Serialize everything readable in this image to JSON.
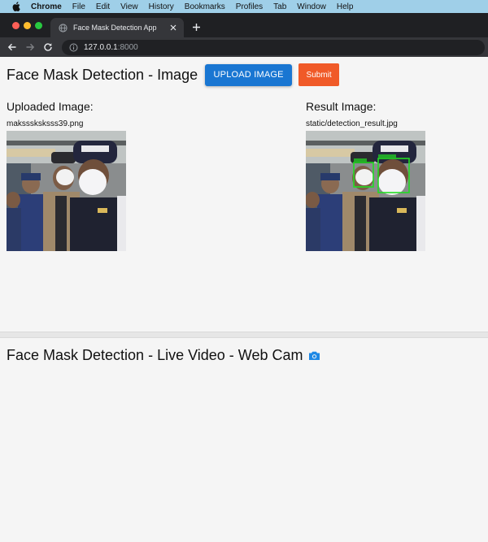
{
  "menubar": {
    "app": "Chrome",
    "items": [
      "File",
      "Edit",
      "View",
      "History",
      "Bookmarks",
      "Profiles",
      "Tab",
      "Window",
      "Help"
    ]
  },
  "browser": {
    "tab_title": "Face Mask Detection App",
    "url_host": "127.0.0.1",
    "url_port": ":8000"
  },
  "page": {
    "image_heading": "Face Mask Detection - Image",
    "upload_button": "UPLOAD IMAGE",
    "submit_button": "Submit",
    "uploaded_label": "Uploaded Image:",
    "uploaded_filename": "maksssksksss39.png",
    "result_label": "Result Image:",
    "result_filename": "static/detection_result.jpg",
    "live_heading": "Face Mask Detection - Live Video - Web Cam"
  },
  "colors": {
    "upload_button": "#1976d2",
    "submit_button": "#f05a28",
    "detection_box": "#22dd22"
  },
  "icons": [
    "apple-icon",
    "globe-icon",
    "close-icon",
    "new-tab-icon",
    "back-icon",
    "forward-icon",
    "reload-icon",
    "info-icon",
    "camera-icon"
  ]
}
